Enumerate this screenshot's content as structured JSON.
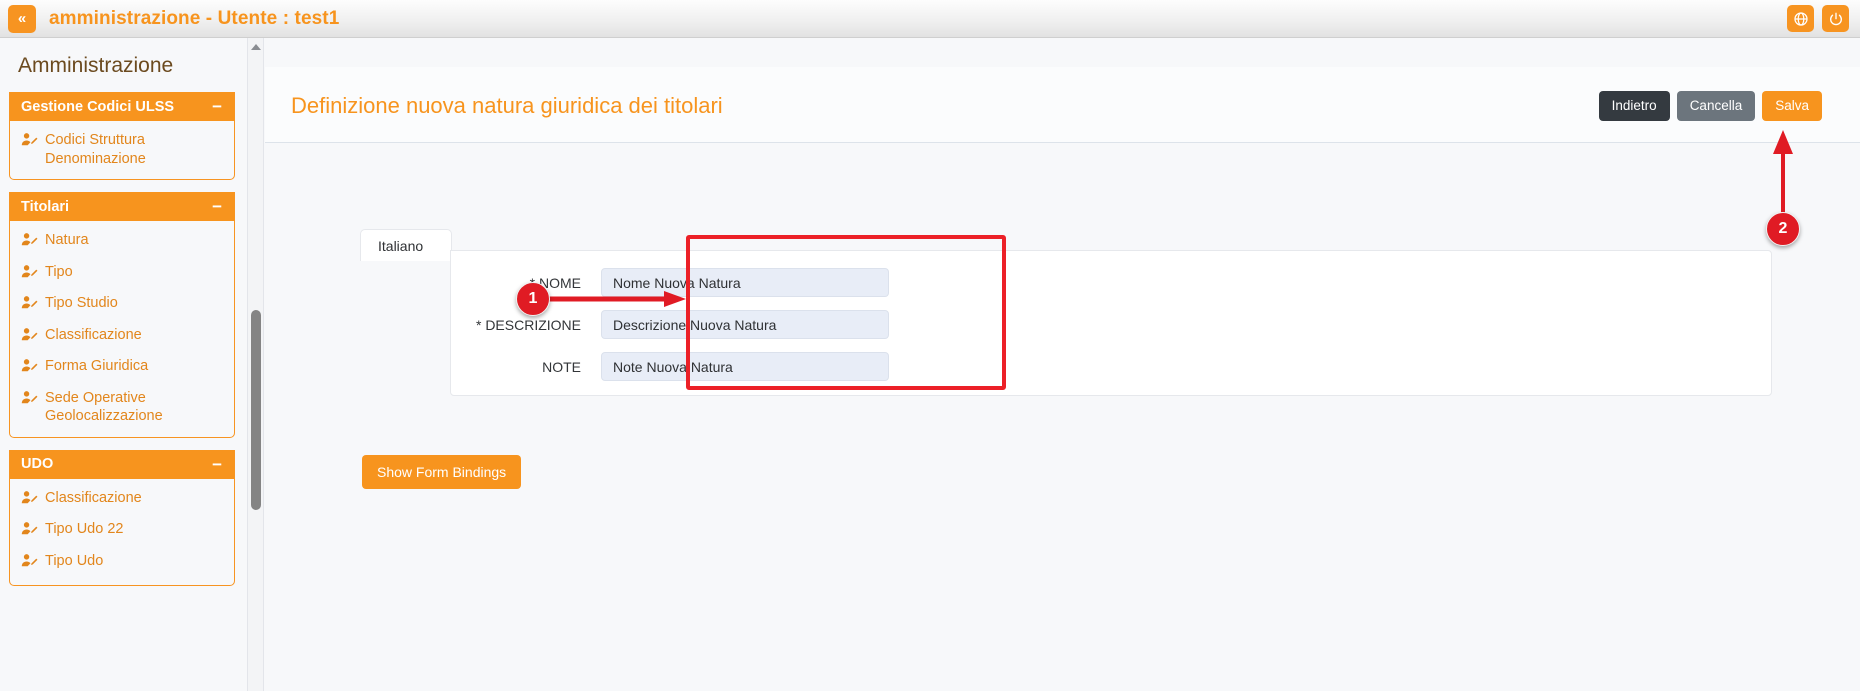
{
  "topbar": {
    "collapse_icon": "double-chevron-left-icon",
    "title": "amministrazione - Utente : test1",
    "language_icon": "globe-icon",
    "power_icon": "power-icon"
  },
  "sidebar": {
    "title": "Amministrazione",
    "collapse_symbol": "−",
    "groups": [
      {
        "label": "Gestione Codici ULSS",
        "items": [
          {
            "label": "Codici Struttura Denominazione",
            "icon": "user-edit-icon"
          }
        ]
      },
      {
        "label": "Titolari",
        "items": [
          {
            "label": "Natura",
            "icon": "user-edit-icon"
          },
          {
            "label": "Tipo",
            "icon": "user-edit-icon"
          },
          {
            "label": "Tipo Studio",
            "icon": "user-edit-icon"
          },
          {
            "label": "Classificazione",
            "icon": "user-edit-icon"
          },
          {
            "label": "Forma Giuridica",
            "icon": "user-edit-icon"
          },
          {
            "label": "Sede Operative Geolocalizzazione",
            "icon": "user-edit-icon"
          }
        ]
      },
      {
        "label": "UDO",
        "items": [
          {
            "label": "Classificazione",
            "icon": "user-edit-icon"
          },
          {
            "label": "Tipo Udo 22",
            "icon": "user-edit-icon"
          },
          {
            "label": "Tipo Udo",
            "icon": "user-edit-icon"
          }
        ]
      }
    ]
  },
  "main": {
    "page_title": "Definizione nuova natura giuridica dei titolari",
    "actions": {
      "back_label": "Indietro",
      "cancel_label": "Cancella",
      "save_label": "Salva"
    },
    "language_tab": "Italiano",
    "form": {
      "fields": [
        {
          "label": "* NOME",
          "value": "Nome Nuova Natura",
          "placeholder": "Nome"
        },
        {
          "label": "* DESCRIZIONE",
          "value": "Descrizione Nuova Natura",
          "placeholder": "Descrizione"
        },
        {
          "label": "NOTE",
          "value": "Note Nuova Natura",
          "placeholder": "Note"
        }
      ]
    },
    "show_bindings_label": "Show Form Bindings"
  },
  "annotations": {
    "badge1": "1",
    "badge2": "2",
    "highlight_color": "#ec2027",
    "badge_color": "#e01b24"
  },
  "theme": {
    "accent": "#f7941e",
    "accent_dark": "#e2861c",
    "dark_button": "#343a40",
    "gray_button": "#6c757d",
    "input_bg": "#e8edf7"
  }
}
